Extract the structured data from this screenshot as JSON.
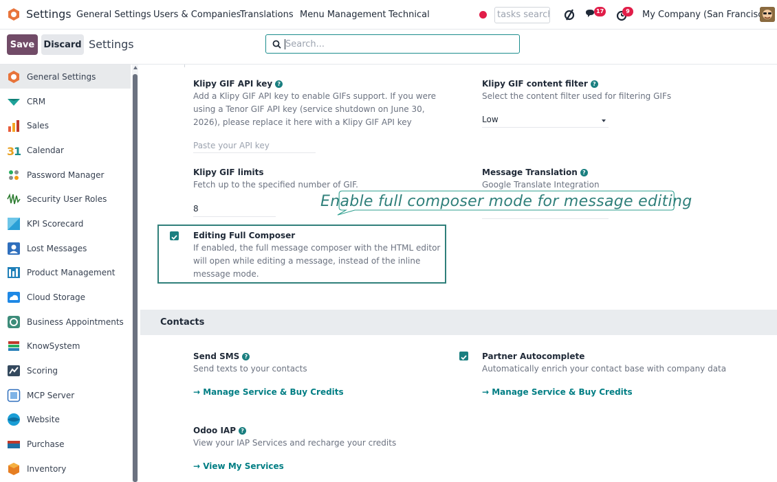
{
  "topbar": {
    "app_name": "Settings",
    "menus": [
      "General Settings",
      "Users & Companies",
      "Translations",
      "Menu Management",
      "Technical"
    ],
    "tasks_search_placeholder": "tasks search",
    "messages_count": "17",
    "activities_count": "9",
    "company": "My Company (San Francisco)"
  },
  "controlbar": {
    "save_label": "Save",
    "discard_label": "Discard",
    "breadcrumb": "Settings",
    "search_placeholder": "Search..."
  },
  "sidebar": {
    "items": [
      {
        "label": "General Settings",
        "icon": "odoo-logo-icon",
        "active": true
      },
      {
        "label": "CRM",
        "icon": "crm-icon"
      },
      {
        "label": "Sales",
        "icon": "sales-chart-icon"
      },
      {
        "label": "Calendar",
        "icon": "calendar-31-icon"
      },
      {
        "label": "Password Manager",
        "icon": "password-manager-icon"
      },
      {
        "label": "Security User Roles",
        "icon": "security-roles-icon"
      },
      {
        "label": "KPI Scorecard",
        "icon": "kpi-scorecard-icon"
      },
      {
        "label": "Lost Messages",
        "icon": "lost-messages-icon"
      },
      {
        "label": "Product Management",
        "icon": "product-management-icon"
      },
      {
        "label": "Cloud Storage",
        "icon": "cloud-storage-icon"
      },
      {
        "label": "Business Appointments",
        "icon": "appointments-icon"
      },
      {
        "label": "KnowSystem",
        "icon": "knowsystem-icon"
      },
      {
        "label": "Scoring",
        "icon": "scoring-icon"
      },
      {
        "label": "MCP Server",
        "icon": "mcp-server-icon"
      },
      {
        "label": "Website",
        "icon": "website-icon"
      },
      {
        "label": "Purchase",
        "icon": "purchase-icon"
      },
      {
        "label": "Inventory",
        "icon": "inventory-icon"
      }
    ]
  },
  "settings": {
    "klipy_key": {
      "title": "Klipy GIF API key",
      "description": "Add a Klipy GIF API key to enable GIFs support. If you were using a Tenor GIF API key (service shutdown on June 30, 2026), please replace it here with a Klipy GIF API key",
      "placeholder": "Paste your API key"
    },
    "klipy_filter": {
      "title": "Klipy GIF content filter",
      "description": "Select the content filter used for filtering GIFs",
      "value": "Low"
    },
    "klipy_limits": {
      "title": "Klipy GIF limits",
      "description": "Fetch up to the specified number of GIF.",
      "value": "8"
    },
    "message_translation": {
      "title": "Message Translation",
      "description": "Google Translate Integration"
    },
    "editing_full_composer": {
      "title": "Editing Full Composer",
      "description": "If enabled, the full message composer with the HTML editor will open while editing a message, instead of the inline message mode.",
      "checked": true
    }
  },
  "contacts": {
    "header": "Contacts",
    "send_sms": {
      "title": "Send SMS",
      "description": "Send texts to your contacts",
      "link": "→ Manage Service & Buy Credits"
    },
    "partner_autocomplete": {
      "title": "Partner Autocomplete",
      "description": "Automatically enrich your contact base with company data",
      "link": "→ Manage Service & Buy Credits",
      "checked": true
    },
    "odoo_iap": {
      "title": "Odoo IAP",
      "description": "View your IAP Services and recharge your credits",
      "link": "→  View My Services"
    }
  },
  "annotation": {
    "callout_text": "Enable full composer mode for message editing",
    "color": "#2f7f7a"
  },
  "colors": {
    "brand": "#714b67",
    "accent": "#017e84"
  }
}
